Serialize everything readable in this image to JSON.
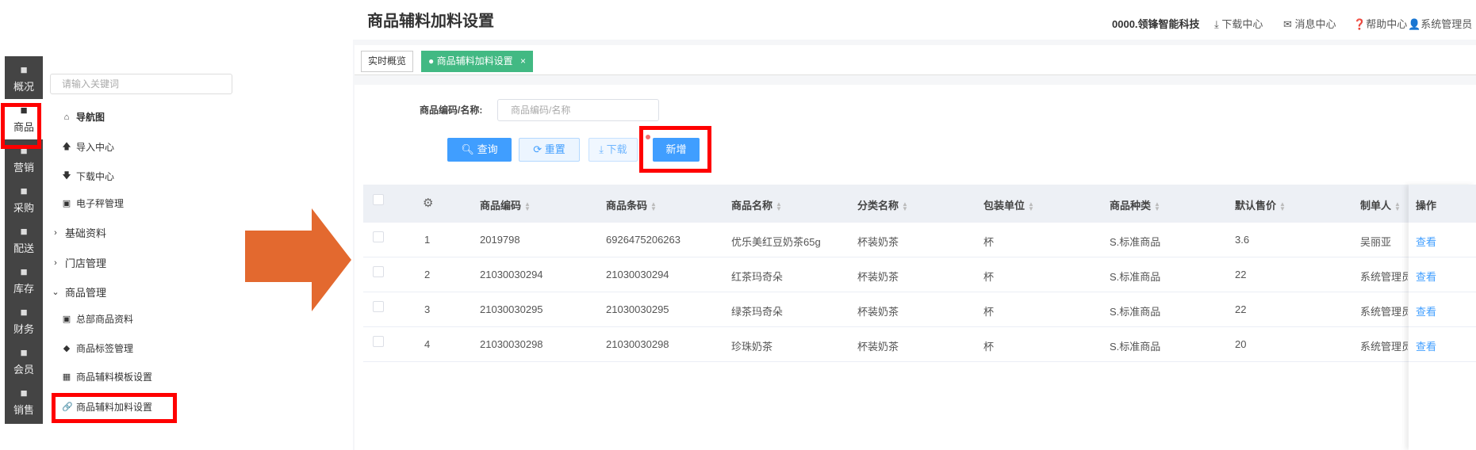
{
  "rail": [
    {
      "label": "概况",
      "icon": "building-icon"
    },
    {
      "label": "商品",
      "icon": "document-icon"
    },
    {
      "label": "营销",
      "icon": "marketing-icon"
    },
    {
      "label": "采购",
      "icon": "cart-icon"
    },
    {
      "label": "配送",
      "icon": "truck-icon"
    },
    {
      "label": "库存",
      "icon": "box-icon"
    },
    {
      "label": "财务",
      "icon": "money-icon"
    },
    {
      "label": "会员",
      "icon": "user-icon"
    },
    {
      "label": "销售",
      "icon": "register-icon"
    }
  ],
  "submenu": {
    "search_placeholder": "请输入关键词",
    "items": [
      {
        "label": "导航图",
        "glyph": "⌂"
      },
      {
        "label": "导入中心",
        "glyph": "🡅"
      },
      {
        "label": "下载中心",
        "glyph": "🡇"
      },
      {
        "label": "电子秤管理",
        "glyph": "▣"
      },
      {
        "label": "基础资料",
        "glyph": "›"
      },
      {
        "label": "门店管理",
        "glyph": "›"
      },
      {
        "label": "商品管理",
        "glyph": "⌄"
      },
      {
        "label": "总部商品资料",
        "glyph": "▣"
      },
      {
        "label": "商品标签管理",
        "glyph": "◆"
      },
      {
        "label": "商品辅料模板设置",
        "glyph": "▦"
      },
      {
        "label": "商品辅料加料设置",
        "glyph": "🔗"
      }
    ]
  },
  "header": {
    "title": "商品辅料加料设置",
    "company": "0000.领锋智能科技",
    "download": "下载中心",
    "messages": "消息中心",
    "help": "帮助中心",
    "user": "系统管理员"
  },
  "tabs": [
    {
      "label": "实时概览"
    },
    {
      "label": "商品辅料加料设置",
      "close": "×"
    }
  ],
  "filter": {
    "label": "商品编码/名称:",
    "placeholder": "商品编码/名称"
  },
  "buttons": {
    "search": "查询",
    "reset": "重置",
    "download": "下载",
    "add": "新增"
  },
  "colors": {
    "accent": "#409eff",
    "tab_active": "#42b983",
    "highlight": "#ff0000",
    "arrow": "#e3692f"
  },
  "table": {
    "headers": [
      "商品编码",
      "商品条码",
      "商品名称",
      "分类名称",
      "包装单位",
      "商品种类",
      "默认售价",
      "制单人",
      "操作"
    ],
    "rows": [
      [
        "1",
        "2019798",
        "6926475206263",
        "优乐美红豆奶茶65g",
        "杯装奶茶",
        "杯",
        "S.标准商品",
        "3.6",
        "吴丽亚",
        "查看"
      ],
      [
        "2",
        "21030030294",
        "21030030294",
        "红茶玛奇朵",
        "杯装奶茶",
        "杯",
        "S.标准商品",
        "22",
        "系统管理员",
        "查看"
      ],
      [
        "3",
        "21030030295",
        "21030030295",
        "绿茶玛奇朵",
        "杯装奶茶",
        "杯",
        "S.标准商品",
        "22",
        "系统管理员",
        "查看"
      ],
      [
        "4",
        "21030030298",
        "21030030298",
        "珍珠奶茶",
        "杯装奶茶",
        "杯",
        "S.标准商品",
        "20",
        "系统管理员",
        "查看"
      ]
    ]
  }
}
